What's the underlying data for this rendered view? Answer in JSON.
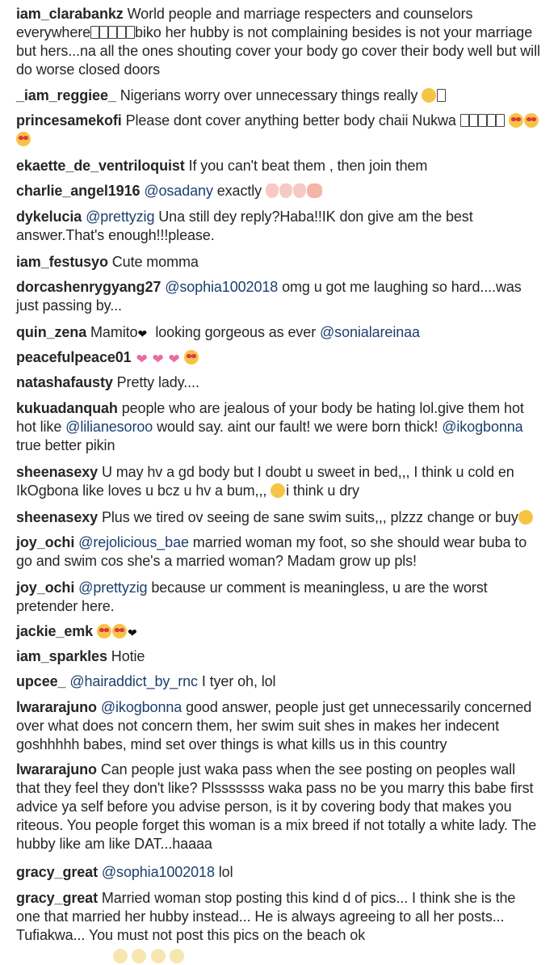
{
  "comments": [
    {
      "user": "iam_clarabankz",
      "text": "World people and marriage respecters and counselors everywhere",
      "text2": "biko her hubby is not complaining besides is not your marriage but hers...na all the ones shouting cover your body go cover their body well but will do worse closed doors",
      "emoji": [
        "box-glyph",
        "box-glyph",
        "box-glyph",
        "box-glyph",
        "box-glyph"
      ]
    },
    {
      "user": "_iam_reggiee_",
      "text": "Nigerians worry over unnecessary things really",
      "emoji": [
        "grinning-squint-face",
        "box-glyph"
      ]
    },
    {
      "user": "princesamekofi",
      "text": "Please dont cover anything better body chaii Nukwa",
      "emoji": [
        "box-glyph",
        "box-glyph",
        "box-glyph",
        "box-glyph",
        "box-glyph",
        "heart-eyes-face",
        "heart-eyes-face",
        "heart-eyes-face"
      ]
    },
    {
      "user": "ekaette_de_ventriloquist",
      "text": "If you can't beat them , then join them"
    },
    {
      "user": "charlie_angel1916",
      "mention": "@osadany",
      "text": "exactly",
      "emoji": [
        "raised-hand",
        "raised-hand",
        "raised-hand",
        "clapping-hands"
      ]
    },
    {
      "user": "dykelucia",
      "mention": "@prettyzig",
      "text": "Una still dey reply?Haba!!IK don give am the best answer.That's enough!!!please."
    },
    {
      "user": "iam_festusyo",
      "text": "Cute momma"
    },
    {
      "user": "dorcashenrygyang27",
      "mention": "@sophia1002018",
      "text": "omg u got me laughing so hard....was just passing by..."
    },
    {
      "user": "quin_zena",
      "text": "Mamito",
      "emoji": [
        "black-heart"
      ],
      "text2": "looking gorgeous as ever",
      "mention2": "@sonialareinaa"
    },
    {
      "user": "peacefulpeace01",
      "emoji": [
        "sparkling-heart",
        "sparkling-heart",
        "sparkling-heart",
        "heart-eyes-face"
      ]
    },
    {
      "user": "natashafausty",
      "text": "Pretty lady...."
    },
    {
      "user": "kukuadanquah",
      "text": "people who are jealous of your body be hating lol.give them hot hot like",
      "mention": "@lilianesoroo",
      "text2": "would say. aint our fault! we were born thick!",
      "mention2": "@ikogbonna",
      "text3": "true better pikin"
    },
    {
      "user": "sheenasexy",
      "text": "U may hv a gd body but I doubt u sweet in bed,,, I think u cold en IkOgbona like loves u bcz u hv a bum,,,",
      "emoji": [
        "grinning-squint-face"
      ],
      "text2": "i think u dry"
    },
    {
      "user": "sheenasexy",
      "text": "Plus we tired ov seeing de sane swim suits,,, plzzz change or buy",
      "emoji": [
        "winking-face"
      ]
    },
    {
      "user": "joy_ochi",
      "mention": "@rejolicious_bae",
      "text": "married woman my foot, so she should wear buba to go and swim cos she's a married woman? Madam grow up pls!"
    },
    {
      "user": "joy_ochi",
      "mention": "@prettyzig",
      "text": "because ur comment is meaningless, u are the worst pretender here."
    },
    {
      "user": "jackie_emk",
      "emoji": [
        "heart-eyes-face",
        "heart-eyes-face",
        "black-heart"
      ]
    },
    {
      "user": "iam_sparkles",
      "text": "Hotie"
    },
    {
      "user": "upcee_",
      "mention": "@hairaddict_by_rnc",
      "text": "I tyer oh, lol"
    },
    {
      "user": "lwararajuno",
      "mention": "@ikogbonna",
      "text": "good answer, people just get unnecessarily concerned over what does not concern them, her swim suit shes in makes her indecent goshhhhh babes, mind set over things is what kills us in this country"
    },
    {
      "user": "lwararajuno",
      "text": "Can people just waka pass when the see posting on peoples wall that they feel they don't like? Plsssssss waka pass no be you marry this babe first advice ya self before you advise person, is it by covering body that makes you riteous. You people forget this woman is a mix breed if not totally a white lady. The hubby like am like DAT...haaaa"
    },
    {
      "user": "gracy_great",
      "mention": "@sophia1002018",
      "text": "lol"
    },
    {
      "user": "gracy_great",
      "text": "Married woman stop posting this kind d of pics... I think she is the one that married her hubby instead... He is always agreeing to all her posts... Tufiakwa... You must not post this pics on the beach ok"
    }
  ]
}
